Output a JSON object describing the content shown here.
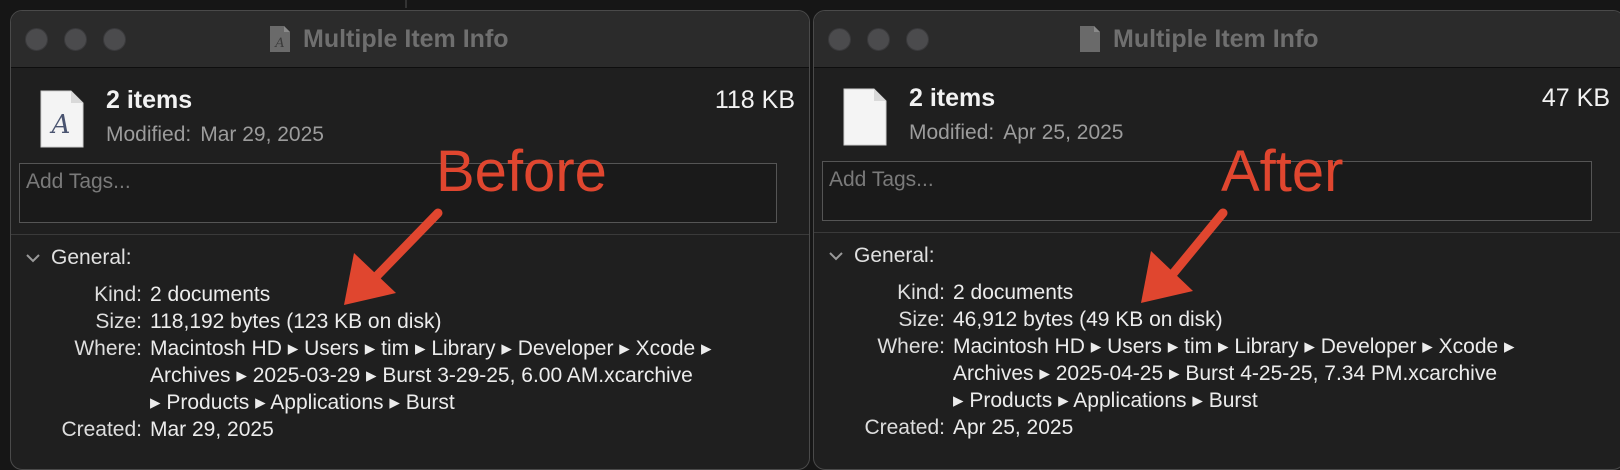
{
  "windows": [
    {
      "title": "Multiple Item Info",
      "items_count": "2 items",
      "modified_label": "Modified:",
      "modified_value": "Mar 29, 2025",
      "total_size": "118 KB",
      "tags_placeholder": "Add Tags...",
      "general_label": "General:",
      "kind_label": "Kind:",
      "kind_value": "2 documents",
      "size_label": "Size:",
      "size_value": "118,192 bytes (123 KB on disk)",
      "where_label": "Where:",
      "where_lines": [
        "Macintosh HD ▸ Users ▸ tim ▸ Library ▸ Developer ▸ Xcode ▸",
        "Archives ▸ 2025-03-29 ▸ Burst 3-29-25, 6.00 AM.xcarchive",
        "▸ Products ▸ Applications ▸ Burst"
      ],
      "created_label": "Created:",
      "created_value": "Mar 29, 2025",
      "annotation": "Before"
    },
    {
      "title": "Multiple Item Info",
      "items_count": "2 items",
      "modified_label": "Modified:",
      "modified_value": "Apr 25, 2025",
      "total_size": "47 KB",
      "tags_placeholder": "Add Tags...",
      "general_label": "General:",
      "kind_label": "Kind:",
      "kind_value": "2 documents",
      "size_label": "Size:",
      "size_value": "46,912 bytes (49 KB on disk)",
      "where_label": "Where:",
      "where_lines": [
        "Macintosh HD ▸ Users ▸ tim ▸ Library ▸ Developer ▸ Xcode ▸",
        "Archives ▸ 2025-04-25 ▸ Burst 4-25-25, 7.34 PM.xcarchive",
        "▸ Products ▸ Applications ▸ Burst"
      ],
      "created_label": "Created:",
      "created_value": "Apr 25, 2025",
      "annotation": "After"
    }
  ],
  "colors": {
    "annotation": "#e0462f",
    "window_bg": "#1f1f1f",
    "titlebar_bg": "#2b2b2b"
  },
  "icons": {
    "left_file": "text-document-icon",
    "right_file": "blank-document-icon"
  }
}
